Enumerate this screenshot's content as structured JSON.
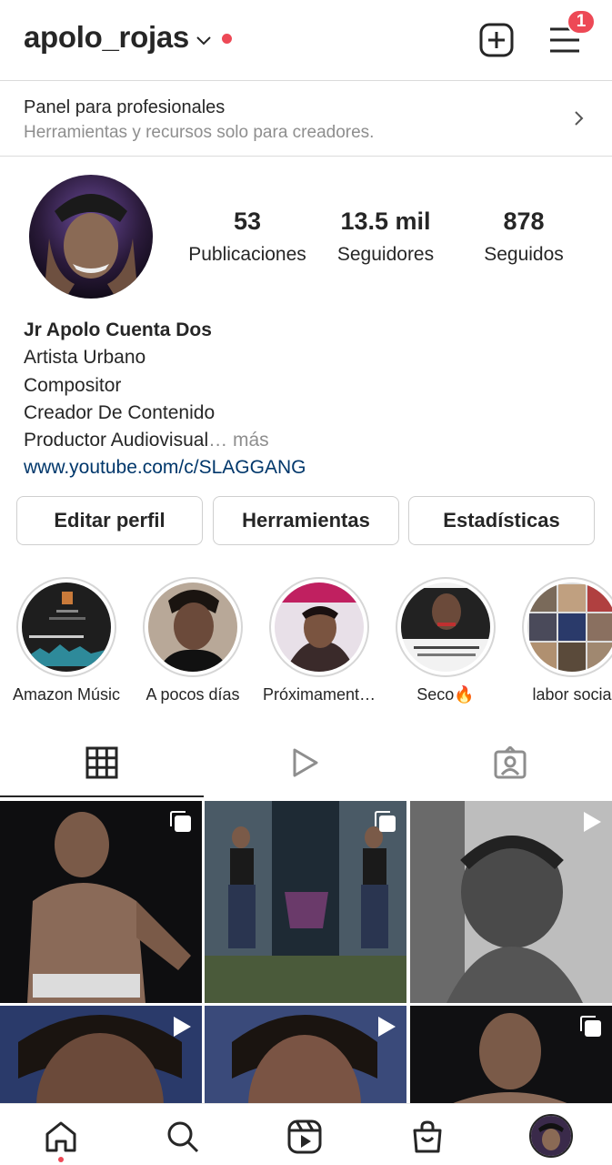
{
  "header": {
    "username": "apolo_rojas",
    "notification_count": "1"
  },
  "panel": {
    "title": "Panel para profesionales",
    "subtitle": "Herramientas y recursos solo para creadores."
  },
  "stats": [
    {
      "value": "53",
      "label": "Publicaciones"
    },
    {
      "value": "13.5 mil",
      "label": "Seguidores"
    },
    {
      "value": "878",
      "label": "Seguidos"
    }
  ],
  "bio": {
    "name": "Jr Apolo Cuenta Dos",
    "lines": [
      "Artista Urbano",
      "Compositor",
      "Creador De Contenido",
      "Productor Audiovisual"
    ],
    "ellipsis": "…",
    "more": "más",
    "link": "www.youtube.com/c/SLAGGANG"
  },
  "buttons": {
    "edit": "Editar perfil",
    "tools": "Herramientas",
    "stats": "Estadísticas"
  },
  "highlights": [
    {
      "label": "Amazon Músic"
    },
    {
      "label": "A pocos días"
    },
    {
      "label": "Próximament…"
    },
    {
      "label": "Seco🔥"
    },
    {
      "label": "labor socia"
    }
  ],
  "tabs": [
    "grid-icon",
    "reels-icon",
    "tagged-icon"
  ],
  "posts": [
    {
      "type": "carousel"
    },
    {
      "type": "carousel"
    },
    {
      "type": "reel"
    },
    {
      "type": "reel"
    },
    {
      "type": "reel"
    },
    {
      "type": "carousel"
    }
  ],
  "colors": {
    "accent_red": "#ed4956",
    "link_blue": "#00376b",
    "muted": "#8e8e8e"
  }
}
